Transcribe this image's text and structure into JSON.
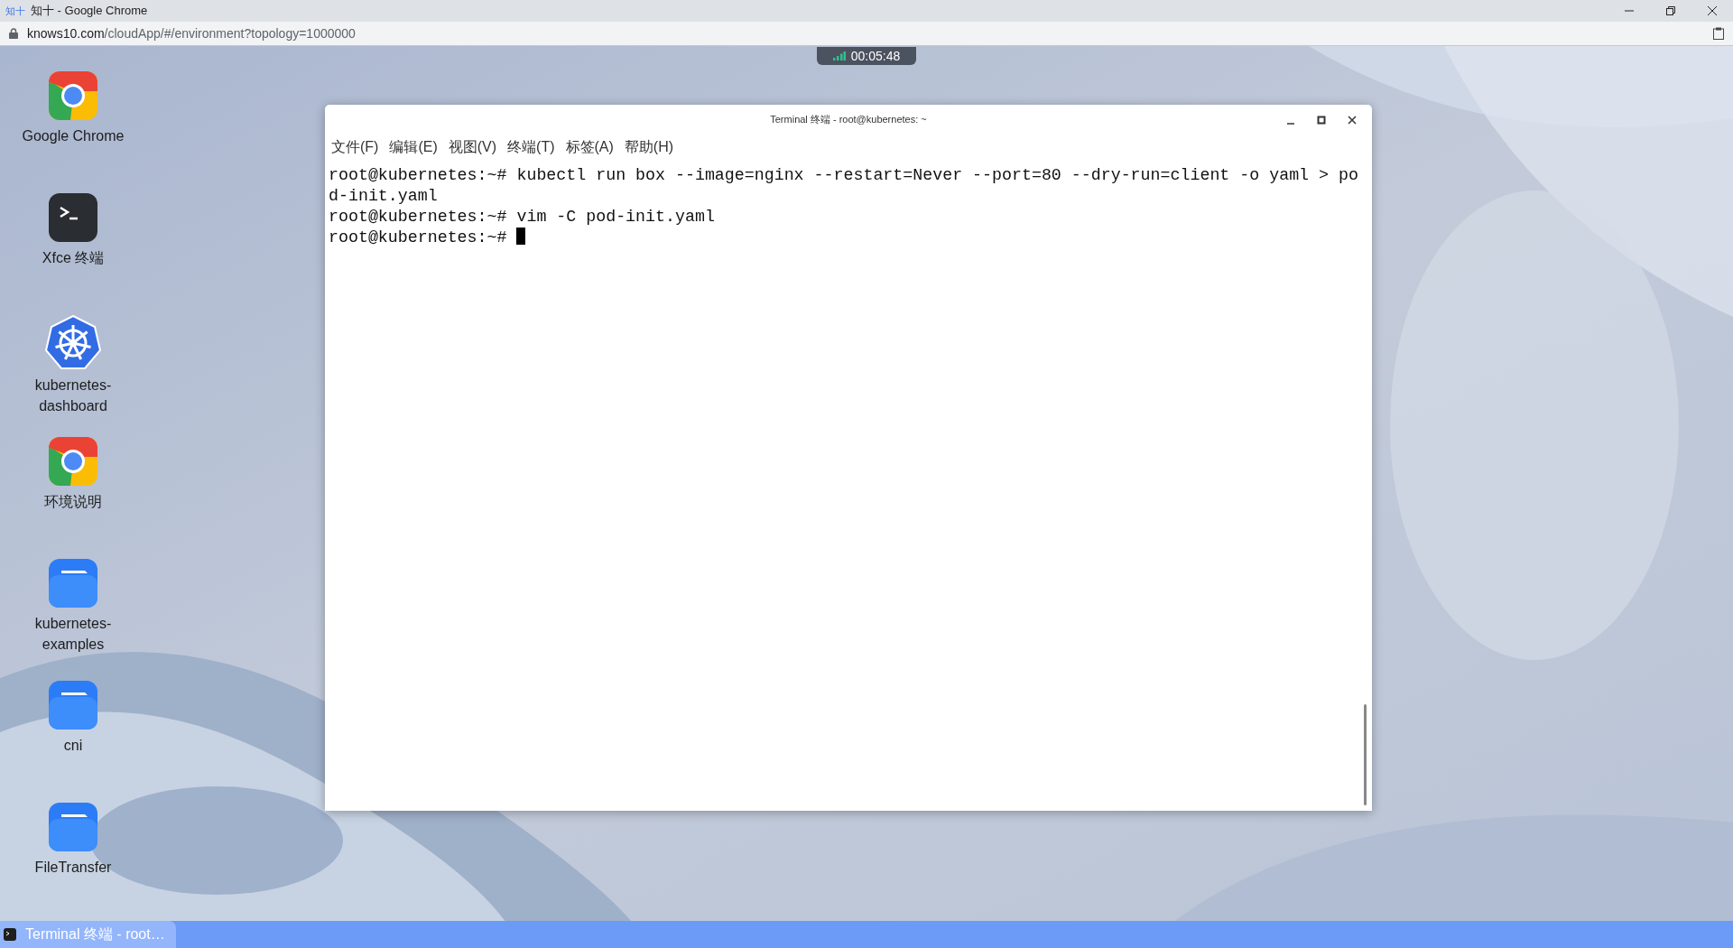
{
  "browser": {
    "tab_title": "知十 - Google Chrome",
    "favicon": "知十",
    "url_host": "knows10.com",
    "url_path": "/cloudApp/#/environment?topology=1000000"
  },
  "session": {
    "timer": "00:05:48"
  },
  "desktop_icons": [
    {
      "kind": "chrome",
      "label": "Google Chrome"
    },
    {
      "kind": "terminal",
      "label": "Xfce 终端"
    },
    {
      "kind": "kubernetes",
      "label": "kubernetes-dashboard"
    },
    {
      "kind": "chrome",
      "label": "环境说明"
    },
    {
      "kind": "folder",
      "label": "kubernetes-examples"
    },
    {
      "kind": "folder",
      "label": "cni"
    },
    {
      "kind": "folder",
      "label": "FileTransfer"
    }
  ],
  "terminal": {
    "title": "Terminal 终端 - root@kubernetes: ~",
    "menu": [
      "文件(F)",
      "编辑(E)",
      "视图(V)",
      "终端(T)",
      "标签(A)",
      "帮助(H)"
    ],
    "lines": [
      "root@kubernetes:~# kubectl run box --image=nginx --restart=Never --port=80 --dry-run=client -o yaml > po",
      "d-init.yaml",
      "root@kubernetes:~# vim -C pod-init.yaml",
      "root@kubernetes:~# "
    ]
  },
  "taskbar": {
    "items": [
      {
        "label": "Terminal 终端 - root…",
        "selected": true
      }
    ]
  }
}
